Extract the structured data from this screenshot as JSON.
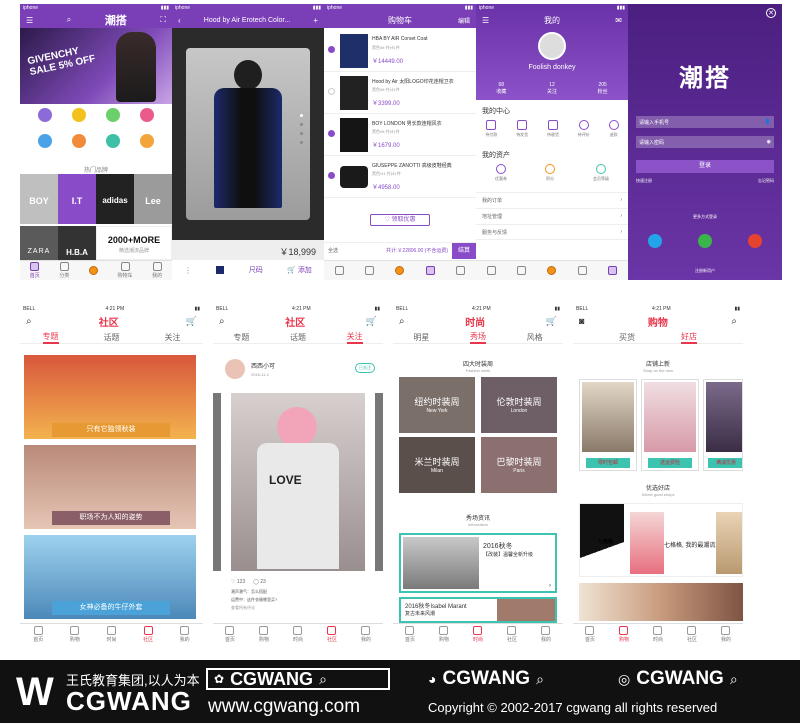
{
  "status": {
    "carrier": "iphone",
    "carrier2": "BELL",
    "time": "4:21 PM"
  },
  "home": {
    "brand": "潮搭",
    "banner_text": "GIVENCHY SALE 5% OFF",
    "categories": [
      "NEW",
      "",
      "",
      "",
      "",
      "",
      "",
      ""
    ],
    "hot_brands_title": "热门品牌",
    "brands": [
      "BOY",
      "I.T",
      "adidas",
      "Lee",
      "ZARA",
      "H.B.A",
      "2000+MORE"
    ],
    "brands_more_sub": "精选潮流品牌",
    "tabs": [
      "首页",
      "分类",
      "",
      "购物车",
      "我的"
    ]
  },
  "product": {
    "title": "Hood by Air Erotech Color...",
    "price": "￥18,999",
    "bar_size": "尺码",
    "bar_add": "添加"
  },
  "cart": {
    "title": "购物车",
    "edit": "编辑",
    "items": [
      {
        "name": "HBA BY AIR Corset Coat",
        "meta": "黑色/M    共计1件",
        "price": "￥14449.00"
      },
      {
        "name": "Hood by Air 太阳LOGO印花连帽卫衣",
        "meta": "黑色/M    共计1件",
        "price": "￥3399.00"
      },
      {
        "name": "BOY LONDON 男长款连帽风衣",
        "meta": "黑色/M    共计1件",
        "price": "￥1679.00"
      },
      {
        "name": "GIUSEPPE ZANOTTI 高级皮鞋经典",
        "meta": "黑色/41    共计1件",
        "price": "￥4958.00"
      }
    ],
    "coupon_btn": "领取优惠",
    "select_all": "全选",
    "total": "共计:￥22806.00 (不含运费)",
    "checkout": "结算"
  },
  "profile": {
    "title": "我的",
    "username": "Foolish donkey",
    "stats": [
      {
        "value": "68",
        "label": "收藏"
      },
      {
        "value": "12",
        "label": "关注"
      },
      {
        "value": "205",
        "label": "粉丝"
      }
    ],
    "center_title": "我的中心",
    "center_items": [
      "待付款",
      "待发货",
      "待收货",
      "待评价",
      "退款"
    ],
    "assets_title": "我的资产",
    "asset_items": [
      "优惠券",
      "积分",
      "会员等级"
    ],
    "rows": [
      "我的订单",
      "地址管理",
      "服务与反馈"
    ]
  },
  "login": {
    "logo": "潮搭",
    "phone_placeholder": "请输入手机号",
    "pwd_placeholder": "请输入密码",
    "login_btn": "登录",
    "register": "快速注册",
    "forgot": "忘记密码",
    "more": "更多方式登录",
    "footer": "注册新用户"
  },
  "community": {
    "title": "社区",
    "tabs": [
      "专题",
      "话题",
      "关注"
    ],
    "cards": [
      "只有它独领秋装",
      "职场不为人知的姿势",
      "女神必备的牛仔外套"
    ],
    "tabbar": [
      "首页",
      "购物",
      "",
      "时尚",
      "社区",
      "我的"
    ]
  },
  "post": {
    "title": "社区",
    "tabs": [
      "专题",
      "话题",
      "关注"
    ],
    "user": "西西小可",
    "date": "2016-11-1",
    "follow": "已关注",
    "likes": "123",
    "comments": "23",
    "comment1": "潮声潮气：怎么搭配",
    "comment2": "运费中：这件衣服哪里买?",
    "more_comments": "查看所有评论"
  },
  "fashion": {
    "title": "时尚",
    "tabs": [
      "明星",
      "秀场",
      "风格"
    ],
    "section1": "四大时装周",
    "section1_sub": "Fashion week",
    "weeks": [
      {
        "cn": "纽约时装周",
        "en": "New York"
      },
      {
        "cn": "伦敦时装周",
        "en": "London"
      },
      {
        "cn": "米兰时装周",
        "en": "Milan"
      },
      {
        "cn": "巴黎时装周",
        "en": "Paris"
      }
    ],
    "section2": "秀场资讯",
    "section2_sub": "Information",
    "news1_title": "2016秋冬",
    "news1_sub": "【改装】温馨全新升级",
    "news2_title": "2016秋冬Isabel Marant",
    "news2_sub": "复古未来风潮"
  },
  "shop": {
    "title": "购物",
    "tabs": [
      "买货",
      "好店"
    ],
    "section1": "店铺上新",
    "section1_sub": "Shop on the new",
    "tags": [
      "限时包邮",
      "送运费险",
      "满减优惠"
    ],
    "section2": "优选好店",
    "section2_sub": "Select good shops",
    "promo": "七格格, 我的最潮流!",
    "shop_name": "七格格"
  },
  "footer": {
    "logo": "CGWANG",
    "slogan": "王氏教育集团,以人为本",
    "site": "www.cgwang.com",
    "copyright": "Copyright © 2002-2017  cgwang all rights reserved"
  },
  "colors": {
    "purple": "#7a3fb7",
    "red": "#e8374c",
    "teal": "#3cc4b0",
    "orange": "#f39316"
  }
}
